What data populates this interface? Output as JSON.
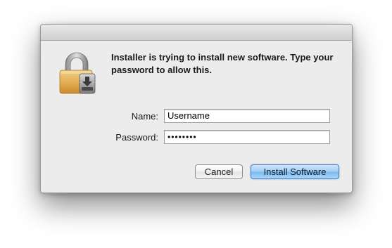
{
  "dialog": {
    "message": "Installer is trying to install new software. Type your password to allow this.",
    "icon": "lock-icon"
  },
  "form": {
    "name_label": "Name:",
    "name_value": "Username",
    "password_label": "Password:",
    "password_value": "••••••••"
  },
  "buttons": {
    "cancel_label": "Cancel",
    "install_label": "Install Software"
  },
  "colors": {
    "dialog_bg": "#ececec",
    "default_button": "#79b7ef",
    "lock_body": "#e6b15a"
  }
}
